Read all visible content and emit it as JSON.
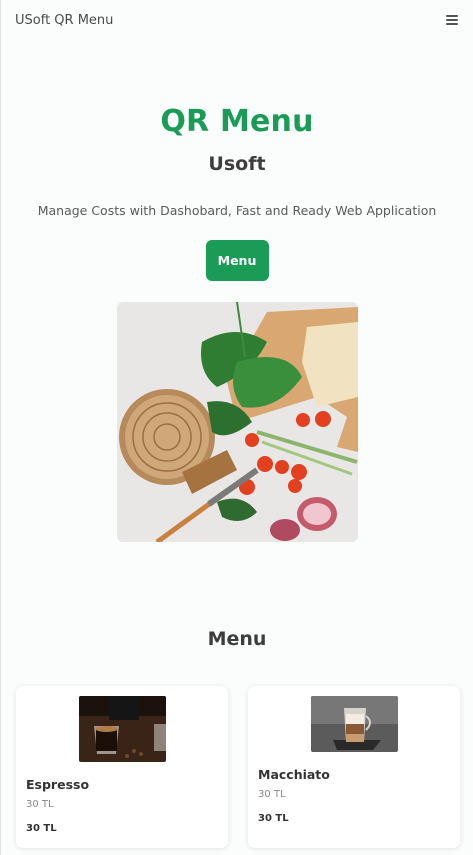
{
  "nav": {
    "brand": "USoft QR Menu",
    "menu_icon": "hamburger-icon"
  },
  "hero": {
    "title": "QR Menu",
    "subtitle": "Usoft",
    "description": "Manage Costs with Dashobard, Fast and Ready Web Application",
    "button_label": "Menu",
    "image_icon": "food-photo"
  },
  "menu": {
    "title": "Menu",
    "items": [
      {
        "name": "Espresso",
        "price_muted": "30 TL",
        "price": "30 TL",
        "image_icon": "espresso-photo"
      },
      {
        "name": "Macchiato",
        "price_muted": "30 TL",
        "price": "30 TL",
        "image_icon": "macchiato-photo"
      }
    ]
  },
  "colors": {
    "accent": "#1a9c57",
    "background": "#fbfdfc",
    "text": "#3d3d3d"
  }
}
